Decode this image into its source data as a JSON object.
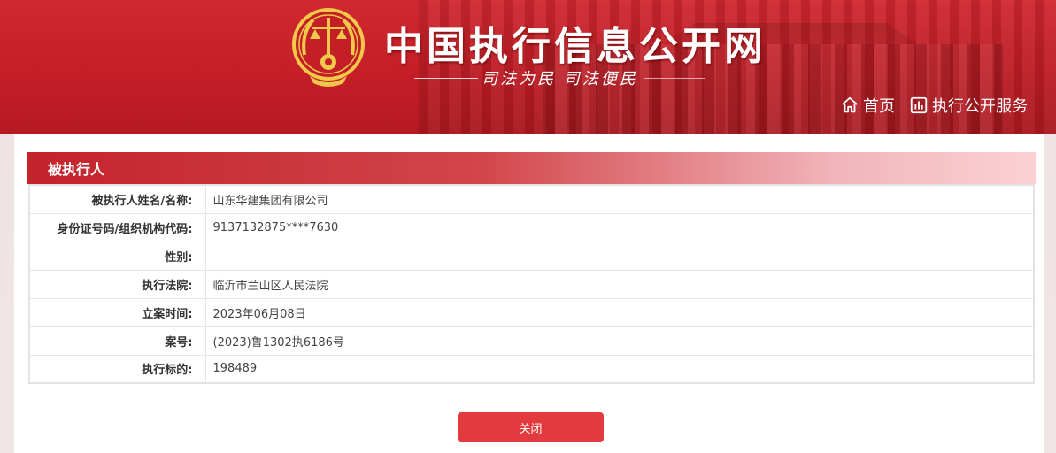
{
  "header": {
    "site_title": "中国执行信息公开网",
    "slogan": "司法为民  司法便民",
    "nav": {
      "home_label": "首页",
      "service_label": "执行公开服务"
    }
  },
  "section": {
    "title": "被执行人"
  },
  "record": {
    "rows": [
      {
        "label": "被执行人姓名/名称:",
        "value": "山东华建集团有限公司"
      },
      {
        "label": "身份证号码/组织机构代码:",
        "value": "9137132875****7630"
      },
      {
        "label": "性别:",
        "value": ""
      },
      {
        "label": "执行法院:",
        "value": "临沂市兰山区人民法院"
      },
      {
        "label": "立案时间:",
        "value": "2023年06月08日"
      },
      {
        "label": "案号:",
        "value": "(2023)鲁1302执6186号"
      },
      {
        "label": "执行标的:",
        "value": "198489"
      }
    ]
  },
  "actions": {
    "close_label": "关闭"
  },
  "colors": {
    "brand_red": "#c41e27",
    "button_red": "#e23a3d",
    "emblem_gold": "#f2c84b"
  },
  "icons": {
    "home": "home-icon",
    "service": "bar-chart-icon",
    "emblem": "national-emblem-icon"
  }
}
